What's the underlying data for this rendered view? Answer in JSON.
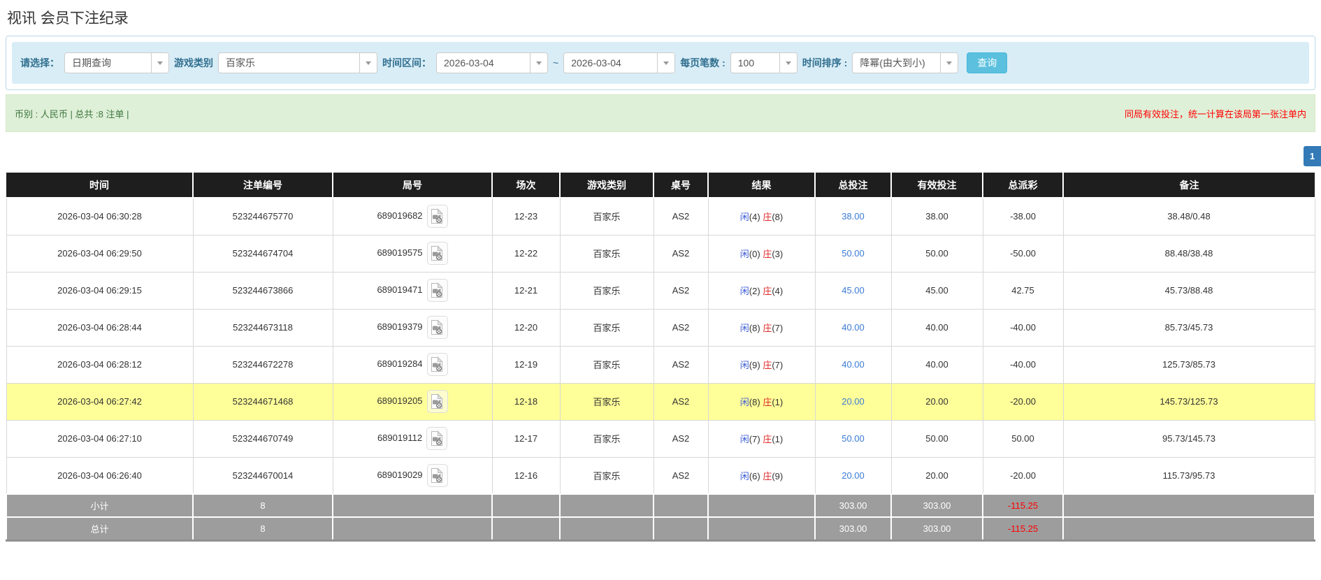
{
  "page_title": "视讯 会员下注纪录",
  "filters": {
    "query_label": "请选择：",
    "query_value": "日期查询",
    "game_type_label": "游戏类别",
    "game_type_value": "百家乐",
    "time_range_label": "时间区间：",
    "date_from": "2026-03-04",
    "tilde": "~",
    "date_to": "2026-03-04",
    "page_size_label": "每页笔数 :",
    "page_size_value": "100",
    "sort_label": "时间排序 :",
    "sort_value": "降幂(由大到小)",
    "search_button": "查询"
  },
  "summary": {
    "left_text": "币别 : 人民币 | 总共 :8 注单 |",
    "right_notice": "同局有效投注，统一计算在该局第一张注单内"
  },
  "pagination": {
    "current_page": "1"
  },
  "icons": {
    "replay": "video-replay-icon",
    "dropdown": "chevron-down-icon"
  },
  "colors": {
    "header_bg": "#1e1e1e",
    "highlight_row": "#ffff99",
    "link_blue": "#3a7bd5",
    "negative_red": "#ff0000",
    "footer_bg": "#9d9d9d",
    "filter_bg": "#d9edf7",
    "summary_bg": "#dff0d8",
    "search_button_bg": "#5bc0de",
    "pagination_bg": "#337ab7"
  },
  "table": {
    "headers": [
      "时间",
      "注单编号",
      "局号",
      "场次",
      "游戏类别",
      "桌号",
      "结果",
      "总投注",
      "有效投注",
      "总派彩",
      "备注"
    ],
    "rows": [
      {
        "time": "2026-03-04 06:30:28",
        "bet_id": "523244675770",
        "round_id": "689019682",
        "session": "12-23",
        "game": "百家乐",
        "table_no": "AS2",
        "player_label": "闲",
        "player_num": "(4)",
        "banker_label": "庄",
        "banker_num": "(8)",
        "total_bet": "38.00",
        "valid_bet": "38.00",
        "payout": "-38.00",
        "remark": "38.48/0.48",
        "highlight": false
      },
      {
        "time": "2026-03-04 06:29:50",
        "bet_id": "523244674704",
        "round_id": "689019575",
        "session": "12-22",
        "game": "百家乐",
        "table_no": "AS2",
        "player_label": "闲",
        "player_num": "(0)",
        "banker_label": "庄",
        "banker_num": "(3)",
        "total_bet": "50.00",
        "valid_bet": "50.00",
        "payout": "-50.00",
        "remark": "88.48/38.48",
        "highlight": false
      },
      {
        "time": "2026-03-04 06:29:15",
        "bet_id": "523244673866",
        "round_id": "689019471",
        "session": "12-21",
        "game": "百家乐",
        "table_no": "AS2",
        "player_label": "闲",
        "player_num": "(2)",
        "banker_label": "庄",
        "banker_num": "(4)",
        "total_bet": "45.00",
        "valid_bet": "45.00",
        "payout": "42.75",
        "remark": "45.73/88.48",
        "highlight": false
      },
      {
        "time": "2026-03-04 06:28:44",
        "bet_id": "523244673118",
        "round_id": "689019379",
        "session": "12-20",
        "game": "百家乐",
        "table_no": "AS2",
        "player_label": "闲",
        "player_num": "(8)",
        "banker_label": "庄",
        "banker_num": "(7)",
        "total_bet": "40.00",
        "valid_bet": "40.00",
        "payout": "-40.00",
        "remark": "85.73/45.73",
        "highlight": false
      },
      {
        "time": "2026-03-04 06:28:12",
        "bet_id": "523244672278",
        "round_id": "689019284",
        "session": "12-19",
        "game": "百家乐",
        "table_no": "AS2",
        "player_label": "闲",
        "player_num": "(9)",
        "banker_label": "庄",
        "banker_num": "(7)",
        "total_bet": "40.00",
        "valid_bet": "40.00",
        "payout": "-40.00",
        "remark": "125.73/85.73",
        "highlight": false
      },
      {
        "time": "2026-03-04 06:27:42",
        "bet_id": "523244671468",
        "round_id": "689019205",
        "session": "12-18",
        "game": "百家乐",
        "table_no": "AS2",
        "player_label": "闲",
        "player_num": "(8)",
        "banker_label": "庄",
        "banker_num": "(1)",
        "total_bet": "20.00",
        "valid_bet": "20.00",
        "payout": "-20.00",
        "remark": "145.73/125.73",
        "highlight": true
      },
      {
        "time": "2026-03-04 06:27:10",
        "bet_id": "523244670749",
        "round_id": "689019112",
        "session": "12-17",
        "game": "百家乐",
        "table_no": "AS2",
        "player_label": "闲",
        "player_num": "(7)",
        "banker_label": "庄",
        "banker_num": "(1)",
        "total_bet": "50.00",
        "valid_bet": "50.00",
        "payout": "50.00",
        "remark": "95.73/145.73",
        "highlight": false
      },
      {
        "time": "2026-03-04 06:26:40",
        "bet_id": "523244670014",
        "round_id": "689019029",
        "session": "12-16",
        "game": "百家乐",
        "table_no": "AS2",
        "player_label": "闲",
        "player_num": "(6)",
        "banker_label": "庄",
        "banker_num": "(9)",
        "total_bet": "20.00",
        "valid_bet": "20.00",
        "payout": "-20.00",
        "remark": "115.73/95.73",
        "highlight": false
      }
    ],
    "footer": [
      {
        "label": "小计",
        "count": "8",
        "total_bet": "303.00",
        "valid_bet": "303.00",
        "payout": "-115.25"
      },
      {
        "label": "总计",
        "count": "8",
        "total_bet": "303.00",
        "valid_bet": "303.00",
        "payout": "-115.25"
      }
    ]
  }
}
